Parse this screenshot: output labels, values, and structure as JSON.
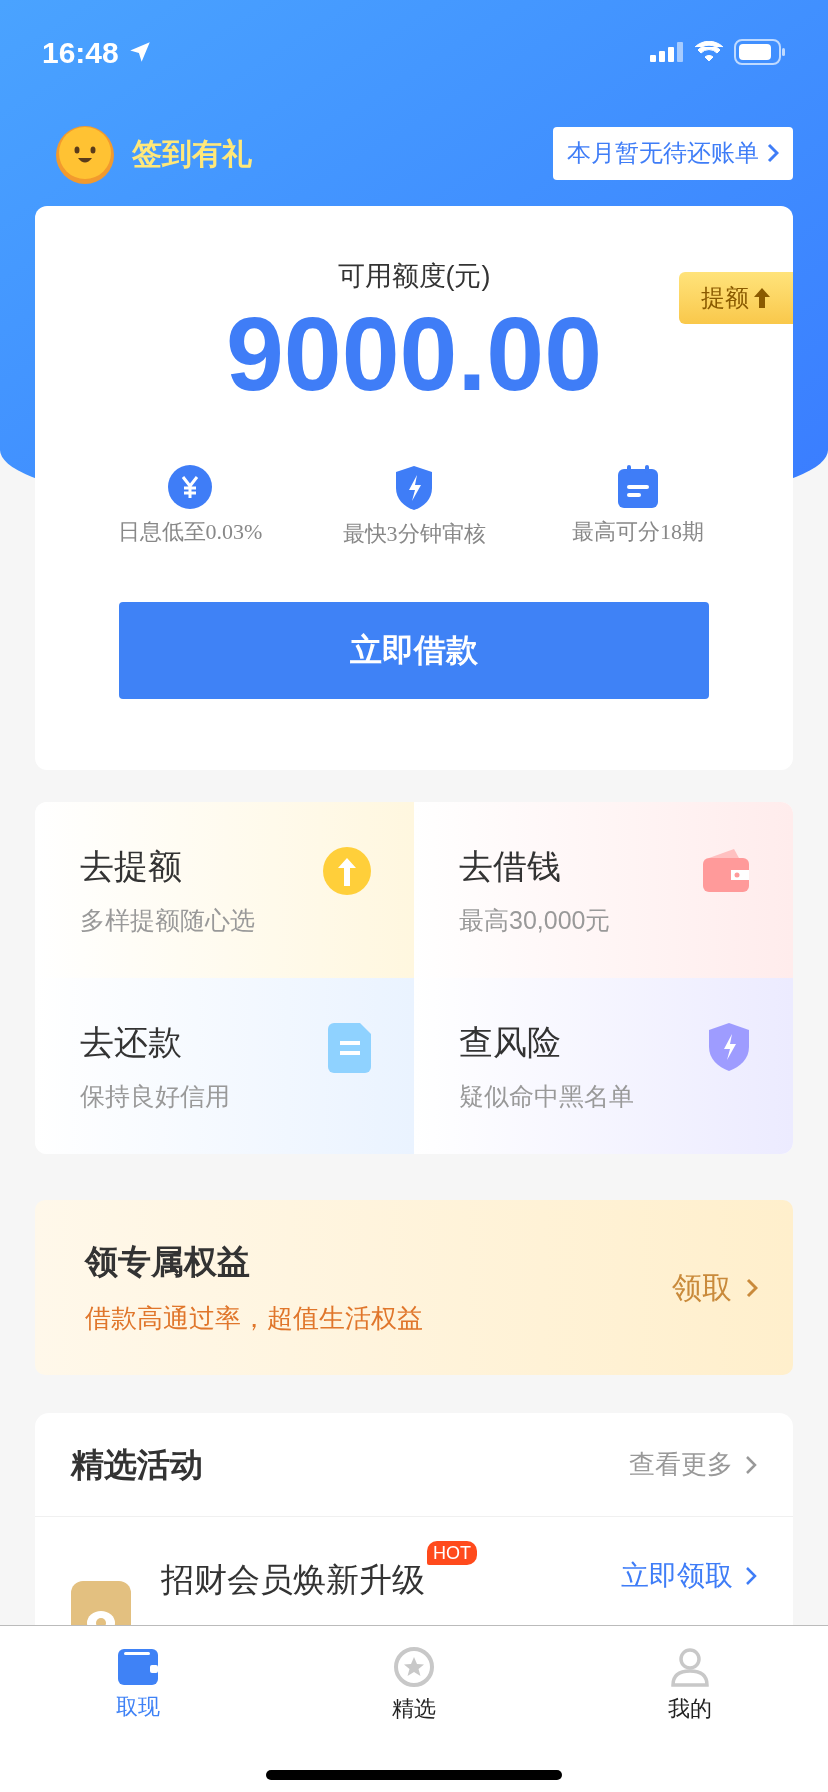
{
  "status_bar": {
    "time": "16:48"
  },
  "header": {
    "checkin_label": "签到有礼",
    "bill_button": "本月暂无待还账单"
  },
  "credit_card": {
    "title": "可用额度(元)",
    "amount": "9000.00",
    "raise_badge": "提额",
    "features": [
      {
        "kind": "yen",
        "label": "日息低至0.03%"
      },
      {
        "kind": "shield",
        "label": "最快3分钟审核"
      },
      {
        "kind": "calendar",
        "label": "最高可分18期"
      }
    ],
    "borrow_button": "立即借款"
  },
  "quick_actions": [
    {
      "kind": "raise",
      "title": "去提额",
      "subtitle": "多样提额随心选"
    },
    {
      "kind": "borrow",
      "title": "去借钱",
      "subtitle": "最高30,000元"
    },
    {
      "kind": "repay",
      "title": "去还款",
      "subtitle": "保持良好信用"
    },
    {
      "kind": "risk",
      "title": "查风险",
      "subtitle": "疑似命中黑名单"
    }
  ],
  "benefits_banner": {
    "title": "领专属权益",
    "subtitle": "借款高通过率，超值生活权益",
    "action": "领取"
  },
  "activities": {
    "title": "精选活动",
    "more": "查看更多",
    "items": [
      {
        "title": "招财会员焕新升级",
        "badge": "HOT",
        "action": "立即领取"
      }
    ]
  },
  "tab_bar": [
    {
      "kind": "wallet",
      "label": "取现",
      "selected": true
    },
    {
      "kind": "star",
      "label": "精选",
      "selected": false
    },
    {
      "kind": "person",
      "label": "我的",
      "selected": false
    }
  ]
}
